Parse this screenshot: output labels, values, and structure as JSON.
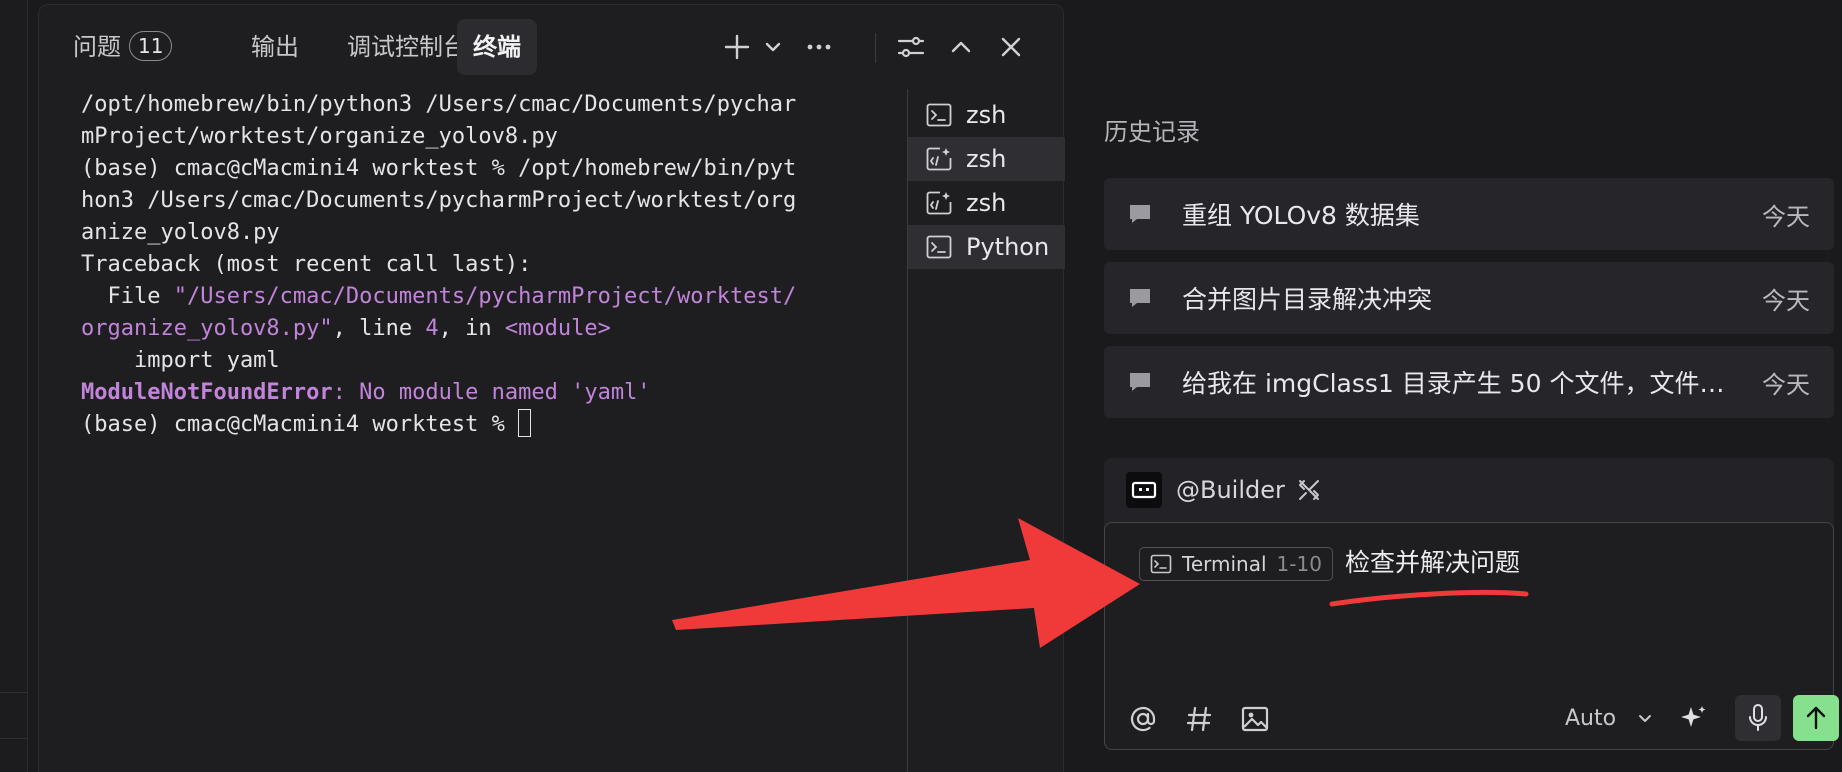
{
  "tabs": [
    {
      "label": "问题",
      "badge": "11"
    },
    {
      "label": "输出"
    },
    {
      "label": "调试控制台"
    },
    {
      "label": "终端",
      "active": true
    }
  ],
  "terminal": {
    "lines": [
      "/opt/homebrew/bin/python3 /Users/cmac/Documents/pychar",
      "mProject/worktest/organize_yolov8.py",
      "(base) cmac@cMacmini4 worktest % /opt/homebrew/bin/pyt",
      "hon3 /Users/cmac/Documents/pycharmProject/worktest/org",
      "anize_yolov8.py",
      "Traceback (most recent call last):",
      "  File ",
      "\"/Users/cmac/Documents/pycharmProject/worktest/",
      "organize_yolov8.py\"",
      ", line ",
      "4",
      ", in ",
      "<module>",
      "    import yaml",
      "ModuleNotFoundError",
      ": No module named 'yaml'",
      "(base) cmac@cMacmini4 worktest % "
    ]
  },
  "sessions": [
    {
      "label": "zsh",
      "icon": "terminal-icon"
    },
    {
      "label": "zsh",
      "icon": "terminal-ai-icon",
      "selected": true
    },
    {
      "label": "zsh",
      "icon": "terminal-ai-icon"
    },
    {
      "label": "Python",
      "icon": "terminal-icon",
      "selected": true
    }
  ],
  "history": {
    "title": "历史记录",
    "items": [
      {
        "text": "重组 YOLOv8 数据集",
        "date": "今天"
      },
      {
        "text": "合并图片目录解决冲突",
        "date": "今天"
      },
      {
        "text": "给我在 imgClass1 目录产生 50 个文件，文件…",
        "date": "今天"
      }
    ]
  },
  "chat": {
    "agent": "@Builder",
    "chip_label": "Terminal",
    "chip_range": "1-10",
    "prompt": "检查并解决问题",
    "model": "Auto"
  },
  "colors": {
    "accent_send": "#86e08e",
    "annotation_red": "#f03a3a",
    "terminal_highlight": "#c084d8"
  }
}
